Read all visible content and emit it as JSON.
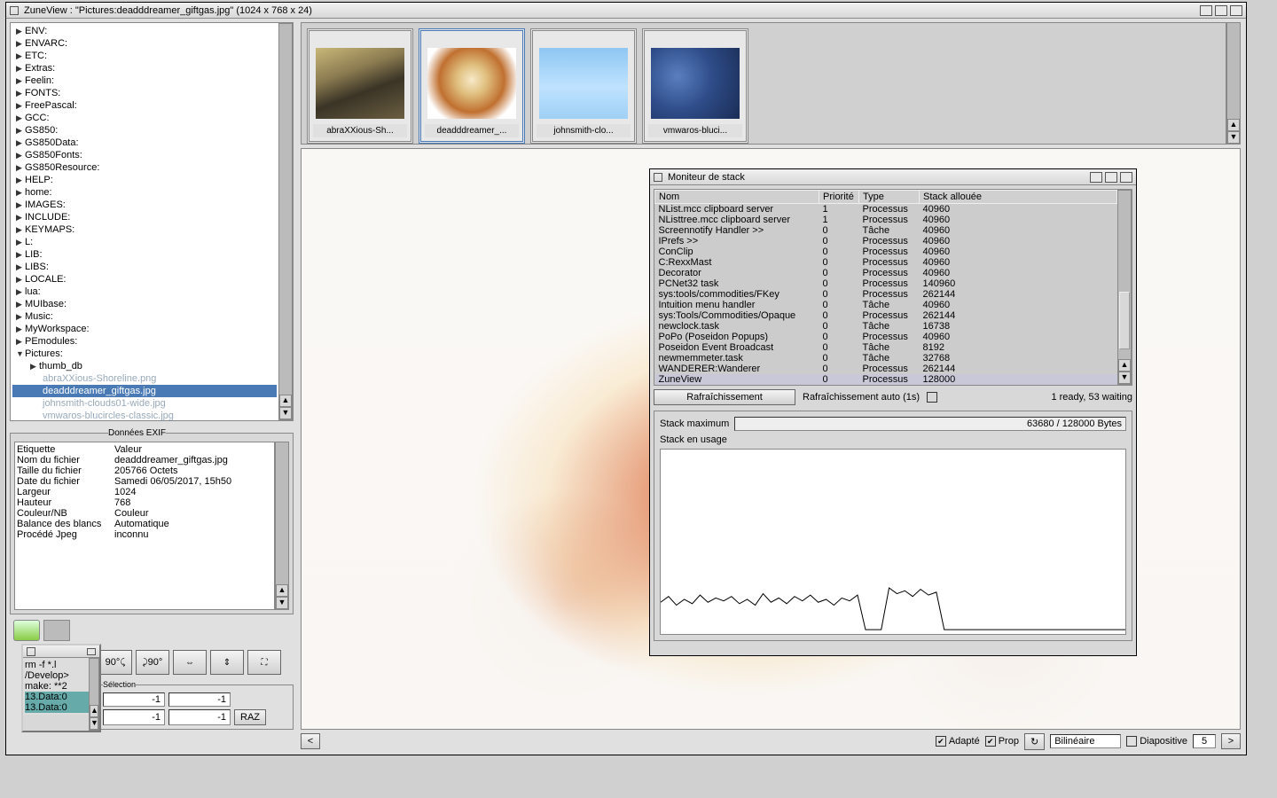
{
  "main_window": {
    "title": "ZuneView : \"Pictures:deadddreamer_giftgas.jpg\" (1024 x 768 x 24)"
  },
  "folders": [
    "ENV:",
    "ENVARC:",
    "ETC:",
    "Extras:",
    "Feelin:",
    "FONTS:",
    "FreePascal:",
    "GCC:",
    "GS850:",
    "GS850Data:",
    "GS850Fonts:",
    "GS850Resource:",
    "HELP:",
    "home:",
    "IMAGES:",
    "INCLUDE:",
    "KEYMAPS:",
    "L:",
    "LIB:",
    "LIBS:",
    "LOCALE:",
    "lua:",
    "MUIbase:",
    "Music:",
    "MyWorkspace:",
    "PEmodules:"
  ],
  "pictures_label": "Pictures:",
  "thumb_db_label": "thumb_db",
  "file_ghost1": "abraXXious-Shoreline.png",
  "file_selected": "deadddreamer_giftgas.jpg",
  "file_ghost2": "johnsmith-clouds01-wide.jpg",
  "file_ghost3": "vmwaros-blucircles-classic.jpg",
  "exif": {
    "legend": "Données EXIF",
    "col_label": "Etiquette",
    "col_value": "Valeur",
    "rows": [
      [
        "Nom du fichier",
        "deadddreamer_giftgas.jpg"
      ],
      [
        "Taille du fichier",
        "205766 Octets"
      ],
      [
        "Date du fichier",
        "Samedi 06/05/2017, 15h50"
      ],
      [
        "Largeur",
        "1024"
      ],
      [
        "Hauteur",
        "768"
      ],
      [
        "Couleur/NB",
        "Couleur"
      ],
      [
        "Balance des blancs",
        "Automatique"
      ],
      [
        "Procédé Jpeg",
        "inconnu"
      ]
    ]
  },
  "toolbar": {
    "r90": "90°",
    "r90b": "90°"
  },
  "selection": {
    "legend": "Sélection",
    "v1": "-1",
    "v2": "-1",
    "v3": "-1",
    "v4": "-1",
    "raz": "RAZ"
  },
  "thumbs": [
    {
      "label": "abraXXious-Sh...",
      "selected": false
    },
    {
      "label": "deadddreamer_...",
      "selected": true
    },
    {
      "label": "johnsmith-clo...",
      "selected": false
    },
    {
      "label": "vmwaros-bluci...",
      "selected": false
    }
  ],
  "bottombar": {
    "adapte": "Adapté",
    "prop": "Prop",
    "bilin": "Bilinéaire",
    "diapo": "Diapositive",
    "diapo_n": "5"
  },
  "monitor": {
    "title": "Moniteur de stack",
    "col_nom": "Nom",
    "col_pri": "Priorité",
    "col_type": "Type",
    "col_stack": "Stack allouée",
    "rows": [
      [
        "NList.mcc clipboard server",
        "1",
        "Processus",
        "40960"
      ],
      [
        "NListtree.mcc clipboard server",
        "1",
        "Processus",
        "40960"
      ],
      [
        "Screennotify Handler >>",
        "0",
        "Tâche",
        "40960"
      ],
      [
        "IPrefs >>",
        "0",
        "Processus",
        "40960"
      ],
      [
        "ConClip",
        "0",
        "Processus",
        "40960"
      ],
      [
        "C:RexxMast",
        "0",
        "Processus",
        "40960"
      ],
      [
        "Decorator",
        "0",
        "Processus",
        "40960"
      ],
      [
        "PCNet32 task",
        "0",
        "Processus",
        "140960"
      ],
      [
        "sys:tools/commodities/FKey",
        "0",
        "Processus",
        "262144"
      ],
      [
        "Intuition menu handler",
        "0",
        "Tâche",
        "40960"
      ],
      [
        "sys:Tools/Commodities/Opaque",
        "0",
        "Processus",
        "262144"
      ],
      [
        "newclock.task",
        "0",
        "Tâche",
        "16738"
      ],
      [
        "PoPo (Poseidon Popups)",
        "0",
        "Processus",
        "40960"
      ],
      [
        "Poseidon Event Broadcast",
        "0",
        "Tâche",
        "8192"
      ],
      [
        "newmemmeter.task",
        "0",
        "Tâche",
        "32768"
      ],
      [
        "WANDERER:Wanderer",
        "0",
        "Processus",
        "262144"
      ],
      [
        "ZuneView",
        "0",
        "Processus",
        "128000"
      ]
    ],
    "refresh": "Rafraîchissement",
    "auto": "Rafraîchissement auto (1s)",
    "status": "1 ready, 53 waiting",
    "stack_max_label": "Stack maximum",
    "stack_max_val": "63680 / 128000 Bytes",
    "stack_usage": "Stack en usage"
  },
  "mini": {
    "l1": "rm -f *.l",
    "l2": "/Develop>",
    "l3": "make: **2",
    "l4": "13.Data:0",
    "l5": "13.Data:0"
  },
  "chart_data": {
    "type": "line",
    "title": "Stack en usage",
    "xlabel": "",
    "ylabel": "",
    "ylim": [
      0,
      128000
    ],
    "x": [
      0,
      1,
      2,
      3,
      4,
      5,
      6,
      7,
      8,
      9,
      10,
      11,
      12,
      13,
      14,
      15,
      16,
      17,
      18,
      19,
      20,
      21,
      22,
      23,
      24,
      25,
      26,
      27,
      28,
      29,
      30,
      31,
      32,
      33,
      34,
      35,
      36,
      37,
      38,
      39,
      40,
      41,
      42,
      43,
      44,
      45,
      46,
      47,
      48,
      49,
      50,
      51,
      52,
      53,
      54,
      55,
      56,
      57,
      58,
      59
    ],
    "values": [
      22000,
      26000,
      20000,
      24000,
      21000,
      27000,
      22000,
      25000,
      23000,
      26000,
      21000,
      24000,
      20000,
      28000,
      22000,
      25000,
      21000,
      26000,
      23000,
      27000,
      22000,
      24000,
      20000,
      25000,
      23000,
      27000,
      3000,
      3000,
      3000,
      32000,
      28000,
      30000,
      26000,
      31000,
      27000,
      29000,
      3000,
      3000,
      3000,
      3000,
      3000,
      3000,
      3000,
      3000,
      3000,
      3000,
      3000,
      3000,
      3000,
      3000,
      3000,
      3000,
      3000,
      3000,
      3000,
      3000,
      3000,
      3000,
      3000,
      3000
    ]
  }
}
